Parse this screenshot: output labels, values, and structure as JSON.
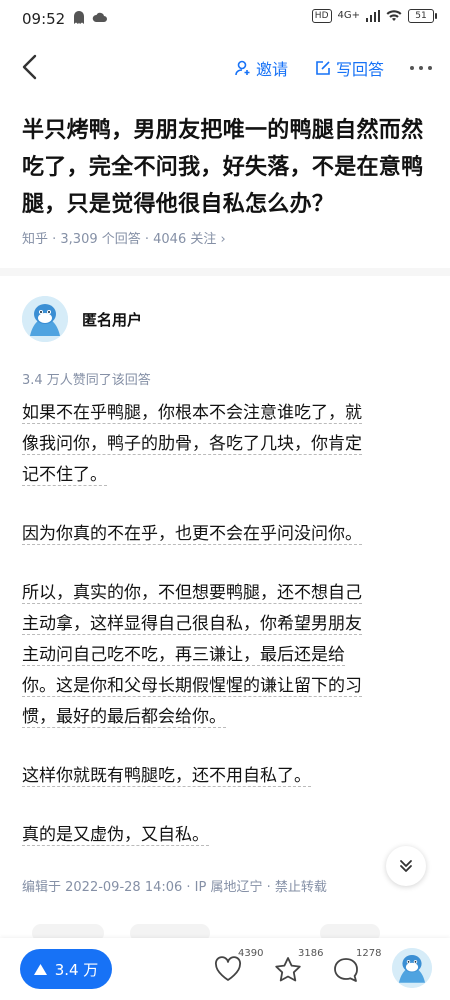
{
  "status_bar": {
    "time": "09:52",
    "hd": "HD",
    "network": "4G+",
    "battery": "51"
  },
  "nav": {
    "invite_label": "邀请",
    "write_answer_label": "写回答"
  },
  "question": {
    "title": "半只烤鸭，男朋友把唯一的鸭腿自然而然吃了，完全不问我，好失落，不是在意鸭腿，只是觉得他很自私怎么办？",
    "meta": "知乎 · 3,309 个回答 · 4046 关注 ›"
  },
  "answer": {
    "author": "匿名用户",
    "upvoted_text": "3.4 万人赞同了该回答",
    "paragraphs": [
      {
        "lines": [
          "如果不在乎鸭腿，你根本不会注意谁吃了，就",
          "像我问你，鸭子的肋骨，各吃了几块，你肯定",
          "记不住了。"
        ]
      },
      {
        "lines": [
          "因为你真的不在乎，也更不会在乎问没问你。"
        ]
      },
      {
        "lines": [
          "所以，真实的你，不但想要鸭腿，还不想自己",
          "主动拿，这样显得自己很自私，你希望男朋友",
          "主动问自己吃不吃，再三谦让，最后还是给",
          "你。这是你和父母长期假惺惺的谦让留下的习",
          "惯，最好的最后都会给你。"
        ]
      },
      {
        "lines": [
          "这样你就既有鸭腿吃，还不用自私了。"
        ]
      },
      {
        "lines": [
          "真的是又虚伪，又自私。"
        ]
      }
    ],
    "edit_info": "编辑于 2022-09-28 14:06 · IP 属地辽宁 · 禁止转载"
  },
  "bottom_bar": {
    "vote_label": "3.4 万",
    "like_count": "4390",
    "favorite_count": "3186",
    "comment_count": "1278"
  },
  "colors": {
    "accent": "#1772f6",
    "meta_gray": "#8590a6"
  }
}
